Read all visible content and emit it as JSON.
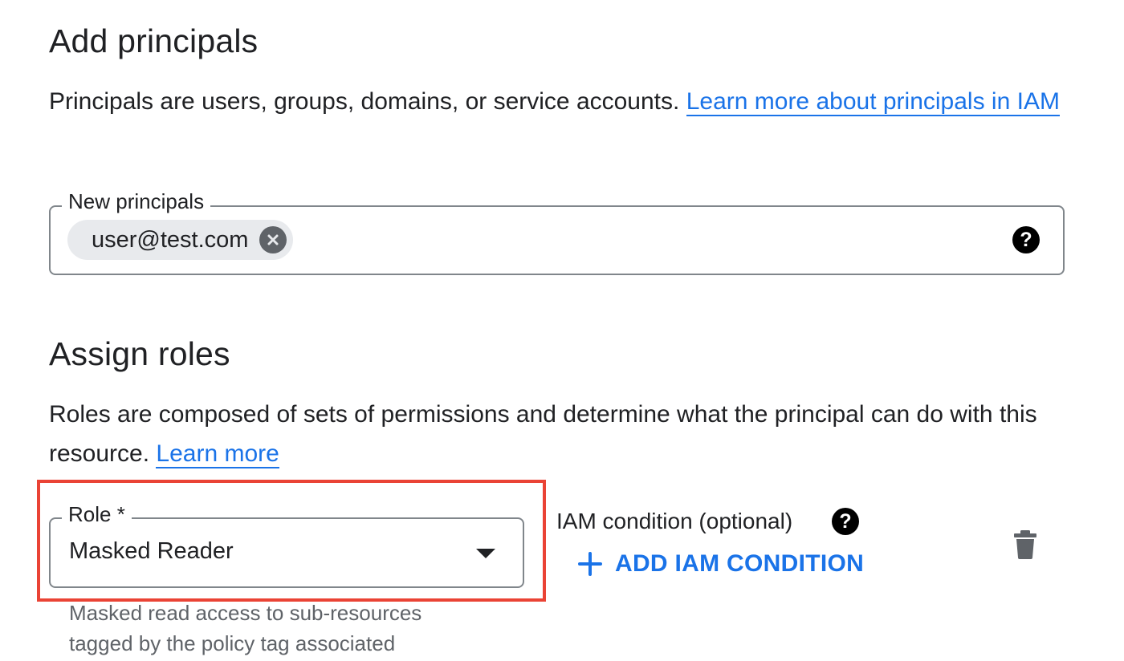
{
  "add_principals": {
    "heading": "Add principals",
    "description": "Principals are users, groups, domains, or service accounts.",
    "learn_more_link": "Learn more about principals in IAM",
    "new_principals_label": "New principals",
    "chips": [
      "user@test.com"
    ]
  },
  "assign_roles": {
    "heading": "Assign roles",
    "description": "Roles are composed of sets of permissions and determine what the principal can do with this resource.",
    "learn_more_link": "Learn more",
    "role_label": "Role *",
    "role_value": "Masked Reader",
    "role_hint": "Masked read access to sub-resources tagged by the policy tag associated",
    "iam_condition_label": "IAM condition (optional)",
    "add_condition_button": "ADD IAM CONDITION",
    "add_condition_icon": "plus-icon"
  },
  "icons": {
    "help": "help-icon",
    "remove_chip": "close-circle-icon",
    "delete": "trash-icon",
    "dropdown": "caret-down-icon"
  },
  "colors": {
    "link": "#1a73e8",
    "highlight": "#ea4335",
    "chip_bg": "#e8eaed"
  }
}
